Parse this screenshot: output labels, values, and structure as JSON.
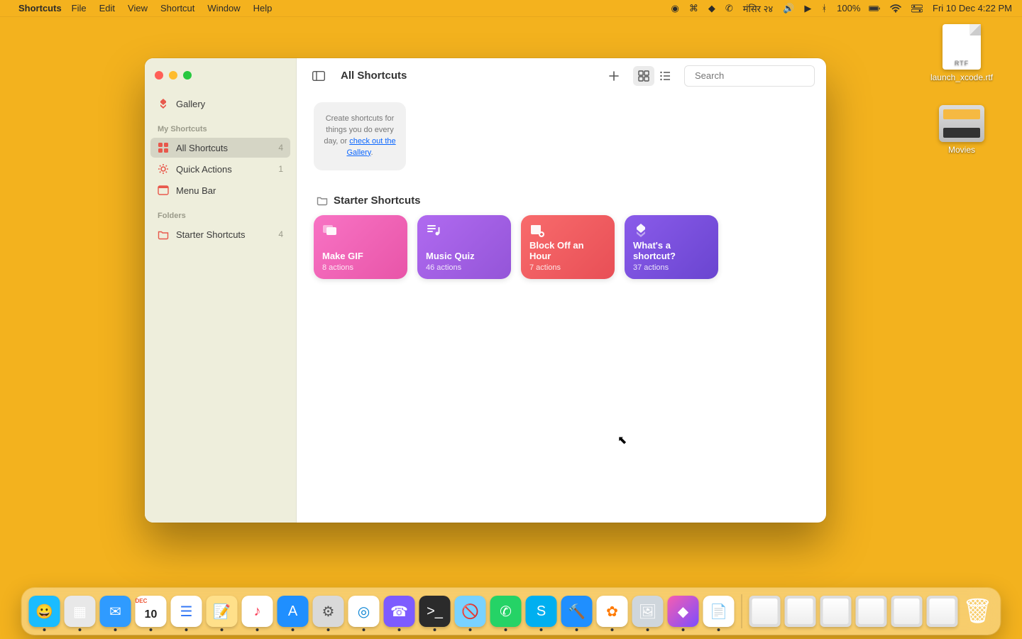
{
  "menubar": {
    "app": "Shortcuts",
    "items": [
      "File",
      "Edit",
      "View",
      "Shortcut",
      "Window",
      "Help"
    ],
    "status": {
      "battery": "100%",
      "locale": "मंसिर २४",
      "clock": "Fri 10 Dec  4:22 PM"
    }
  },
  "desktop": {
    "file1": "launch_xcode.rtf",
    "folder1": "Movies"
  },
  "window": {
    "title": "All Shortcuts",
    "search_placeholder": "Search",
    "hint_pre": "Create shortcuts for things you do every day, or ",
    "hint_link": "check out the Gallery",
    "sidebar": {
      "gallery": "Gallery",
      "head1": "My Shortcuts",
      "all": {
        "label": "All Shortcuts",
        "count": "4"
      },
      "quick": {
        "label": "Quick Actions",
        "count": "1"
      },
      "menu": {
        "label": "Menu Bar",
        "count": ""
      },
      "head2": "Folders",
      "starter": {
        "label": "Starter Shortcuts",
        "count": "4"
      }
    },
    "section": "Starter Shortcuts",
    "cards": [
      {
        "title": "Make GIF",
        "sub": "8 actions"
      },
      {
        "title": "Music Quiz",
        "sub": "46 actions"
      },
      {
        "title": "Block Off an Hour",
        "sub": "7 actions"
      },
      {
        "title": "What's a shortcut?",
        "sub": "37 actions"
      }
    ]
  },
  "dock": {
    "apps": [
      {
        "name": "finder",
        "bg": "#1abcff",
        "glyph": "😀"
      },
      {
        "name": "launchpad",
        "bg": "#e8e8e8",
        "glyph": "▦"
      },
      {
        "name": "mail",
        "bg": "#2f9bff",
        "glyph": "✉"
      },
      {
        "name": "calendar",
        "bg": "#ffffff",
        "glyph": "10",
        "txt": "#222",
        "badge": "DEC"
      },
      {
        "name": "reminders",
        "bg": "#ffffff",
        "glyph": "☰",
        "txt": "#3478f6"
      },
      {
        "name": "notes",
        "bg": "#ffe08a",
        "glyph": "📝"
      },
      {
        "name": "music",
        "bg": "#ffffff",
        "glyph": "♪",
        "txt": "#fa3c55"
      },
      {
        "name": "appstore",
        "bg": "#1f8fff",
        "glyph": "A"
      },
      {
        "name": "settings",
        "bg": "#d9d9d9",
        "glyph": "⚙",
        "txt": "#555"
      },
      {
        "name": "edge",
        "bg": "#ffffff",
        "glyph": "◎",
        "txt": "#0a84d4"
      },
      {
        "name": "viber",
        "bg": "#7d5bff",
        "glyph": "☎"
      },
      {
        "name": "terminal",
        "bg": "#2b2b2b",
        "glyph": ">_"
      },
      {
        "name": "app1",
        "bg": "#79d2ff",
        "glyph": "🚫"
      },
      {
        "name": "whatsapp",
        "bg": "#25d366",
        "glyph": "✆"
      },
      {
        "name": "skype",
        "bg": "#00aff0",
        "glyph": "S"
      },
      {
        "name": "xcode",
        "bg": "#1f8fff",
        "glyph": "🔨"
      },
      {
        "name": "photos",
        "bg": "#ffffff",
        "glyph": "✿",
        "txt": "#ff7a00"
      },
      {
        "name": "preview",
        "bg": "#cfd6dc",
        "glyph": "🖼"
      },
      {
        "name": "shortcuts",
        "bg": "linear-gradient(135deg,#f65db1,#7c4dff)",
        "glyph": "◆"
      },
      {
        "name": "textedit",
        "bg": "#ffffff",
        "glyph": "📄"
      }
    ],
    "mins": 6
  }
}
